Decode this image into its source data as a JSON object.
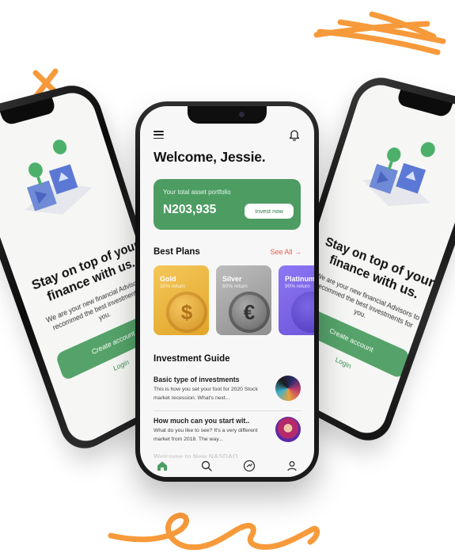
{
  "colors": {
    "accent_green": "#4d9d62",
    "link_red": "#e35d4a",
    "doodle_orange": "#f79a3b"
  },
  "side_phone": {
    "headline": "Stay on top of your finance with us.",
    "subtitle": "We are your new financial Advisors to recommed the best investments for you.",
    "create_label": "Create account",
    "login_label": "Login"
  },
  "main": {
    "greeting": "Welcome, Jessie.",
    "portfolio": {
      "label": "Your total asset portfolio",
      "amount": "N203,935",
      "invest_label": "Invest now"
    },
    "plans_title": "Best Plans",
    "see_all": "See All →",
    "plans": [
      {
        "name": "Gold",
        "return": "30% return",
        "symbol": "$"
      },
      {
        "name": "Silver",
        "return": "60% return",
        "symbol": "€"
      },
      {
        "name": "Platinum",
        "return": "90% return",
        "symbol": ""
      }
    ],
    "guide_title": "Investment Guide",
    "guides": [
      {
        "title": "Basic type of investments",
        "desc": "This is how you set your foot for 2020 Stock market recession. What's next..."
      },
      {
        "title": "How much can you start wit..",
        "desc": "What do you like to see? It's a very different market from 2018. The way..."
      }
    ],
    "faded_item": "Welcome to New NASDAQ",
    "tabs": [
      "home-icon",
      "search-icon",
      "exchange-icon",
      "profile-icon"
    ]
  }
}
